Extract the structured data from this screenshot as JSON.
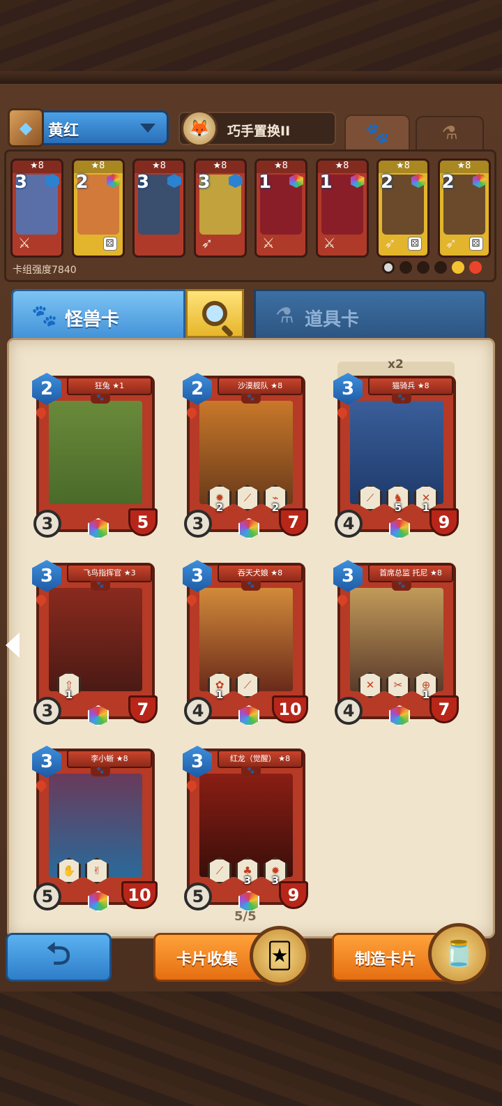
{
  "header": {
    "deck_name": "黄红",
    "ability_label": "巧手置换II",
    "deck_power": "卡组强度7840"
  },
  "deck": [
    {
      "cost": "3",
      "star": "★8",
      "frame": "red",
      "gem": "snow",
      "art": "#5a6fa8",
      "weapon": "sword",
      "dice": false
    },
    {
      "cost": "2",
      "star": "★8",
      "frame": "gold",
      "gem": "rainbow",
      "art": "#d27a3a",
      "weapon": "",
      "dice": true
    },
    {
      "cost": "3",
      "star": "★8",
      "frame": "red",
      "gem": "snow",
      "art": "#3a4e6e",
      "weapon": "",
      "dice": false
    },
    {
      "cost": "3",
      "star": "★8",
      "frame": "red",
      "gem": "snow",
      "art": "#c2a23c",
      "weapon": "bow",
      "dice": false
    },
    {
      "cost": "1",
      "star": "★8",
      "frame": "red",
      "gem": "rainbow",
      "art": "#8a1e28",
      "weapon": "sword",
      "dice": false
    },
    {
      "cost": "1",
      "star": "★8",
      "frame": "red",
      "gem": "rainbow",
      "art": "#8a1e28",
      "weapon": "sword",
      "dice": false
    },
    {
      "cost": "2",
      "star": "★8",
      "frame": "gold",
      "gem": "rainbow",
      "art": "#6a4a2a",
      "weapon": "bow",
      "dice": true
    },
    {
      "cost": "2",
      "star": "★8",
      "frame": "gold",
      "gem": "rainbow",
      "art": "#6a4a2a",
      "weapon": "bow",
      "dice": true
    }
  ],
  "tabs": {
    "monster_label": "怪兽卡",
    "item_label": "道具卡"
  },
  "duplicate_label": "x2",
  "cards": [
    {
      "name": "狂兔 ★1",
      "cost": "2",
      "atk": "3",
      "hp": "5",
      "art": "linear-gradient(#6a8a3a,#4a6a2a)",
      "skills": []
    },
    {
      "name": "沙漠舰队 ★8",
      "cost": "2",
      "atk": "3",
      "hp": "7",
      "art": "linear-gradient(#c8782a,#6a3a1a)",
      "skills": [
        {
          "icon": "✹",
          "num": "2"
        },
        {
          "icon": "⟋",
          "num": ""
        },
        {
          "icon": "⌁",
          "num": "2"
        }
      ]
    },
    {
      "name": "猫骑兵 ★8",
      "cost": "3",
      "atk": "4",
      "hp": "9",
      "art": "linear-gradient(#3a5e9a,#1e3a6a)",
      "skills": [
        {
          "icon": "⟋",
          "num": ""
        },
        {
          "icon": "♞",
          "num": "5"
        },
        {
          "icon": "✕",
          "num": "1"
        }
      ]
    },
    {
      "name": "飞鸟指挥官 ★3",
      "cost": "3",
      "atk": "3",
      "hp": "7",
      "art": "linear-gradient(#8a2a1e,#4a1a14)",
      "skills": [
        {
          "icon": "⇧",
          "num": "1"
        }
      ]
    },
    {
      "name": "吞天犬娘 ★8",
      "cost": "3",
      "atk": "4",
      "hp": "10",
      "art": "linear-gradient(#d28a3a,#6a2a1a)",
      "skills": [
        {
          "icon": "✿",
          "num": "1"
        },
        {
          "icon": "⟋",
          "num": ""
        }
      ]
    },
    {
      "name": "首席总监 托尼 ★8",
      "cost": "3",
      "atk": "4",
      "hp": "7",
      "art": "linear-gradient(#c29a5a,#5a3a2a)",
      "skills": [
        {
          "icon": "✕",
          "num": ""
        },
        {
          "icon": "✂",
          "num": ""
        },
        {
          "icon": "⊕",
          "num": "1"
        }
      ]
    },
    {
      "name": "李小蜥 ★8",
      "cost": "3",
      "atk": "5",
      "hp": "10",
      "art": "linear-gradient(#6a3a5a,#2a6a9a)",
      "skills": [
        {
          "icon": "✋",
          "num": ""
        },
        {
          "icon": "✌",
          "num": ""
        }
      ]
    },
    {
      "name": "红龙（觉醒） ★8",
      "cost": "3",
      "atk": "5",
      "hp": "9",
      "art": "linear-gradient(#8a1e14,#3a0e0a)",
      "skills": [
        {
          "icon": "⟋",
          "num": ""
        },
        {
          "icon": "♣",
          "num": "3"
        },
        {
          "icon": "✹",
          "num": "3"
        }
      ]
    }
  ],
  "page_count": "5/5",
  "bottom": {
    "collect_label": "卡片收集",
    "craft_label": "制造卡片"
  },
  "icons": {
    "deck_book": "book-icon",
    "chevron": "chevron-down-icon",
    "paw": "paw-icon",
    "flask": "flask-icon",
    "search": "search-icon",
    "back": "back-arrow-icon"
  }
}
